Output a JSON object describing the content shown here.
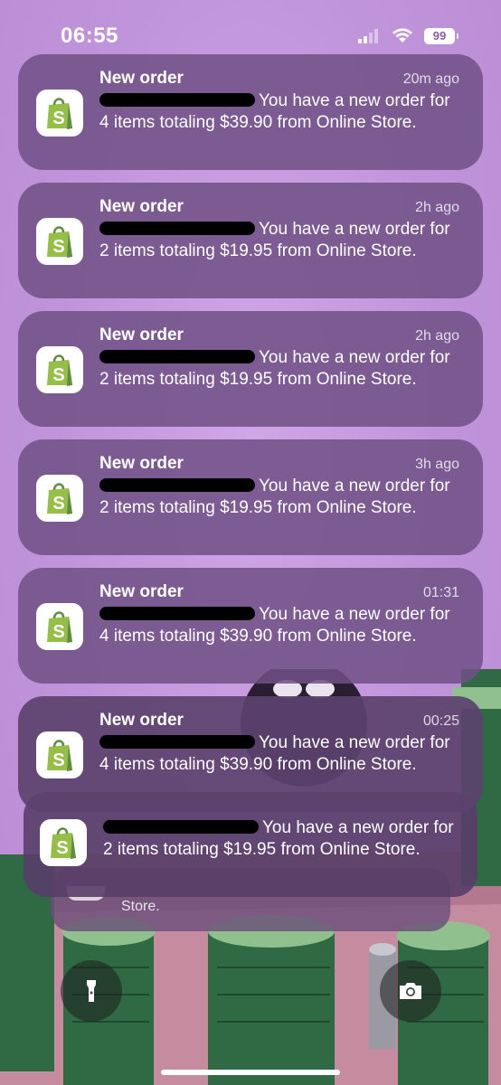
{
  "status_bar": {
    "time": "06:55",
    "battery": "99"
  },
  "notifications": [
    {
      "title": "New order",
      "time": "20m ago",
      "body": "You have a new order for 4 items totaling $39.90 from Online Store."
    },
    {
      "title": "New order",
      "time": "2h ago",
      "body": "You have a new order for 2 items totaling $19.95 from Online Store."
    },
    {
      "title": "New order",
      "time": "2h ago",
      "body": "You have a new order for 2 items totaling $19.95 from Online Store."
    },
    {
      "title": "New order",
      "time": "3h ago",
      "body": "You have a new order for 2 items totaling $19.95 from Online Store."
    },
    {
      "title": "New order",
      "time": "01:31",
      "body": "You have a new order for 4 items totaling $39.90 from Online Store."
    },
    {
      "title": "New order",
      "time": "00:25",
      "body": "You have a new order for 4 items totaling $39.90 from Online Store."
    }
  ],
  "stacked": [
    {
      "body": "You have a new order for 2 items totaling $19.95 from Online Store."
    },
    {
      "body": "Store."
    }
  ],
  "app": {
    "icon": "shopify-bag-icon",
    "accent": "#95bf47"
  },
  "controls": {
    "left_icon": "flashlight-icon",
    "right_icon": "camera-icon"
  }
}
